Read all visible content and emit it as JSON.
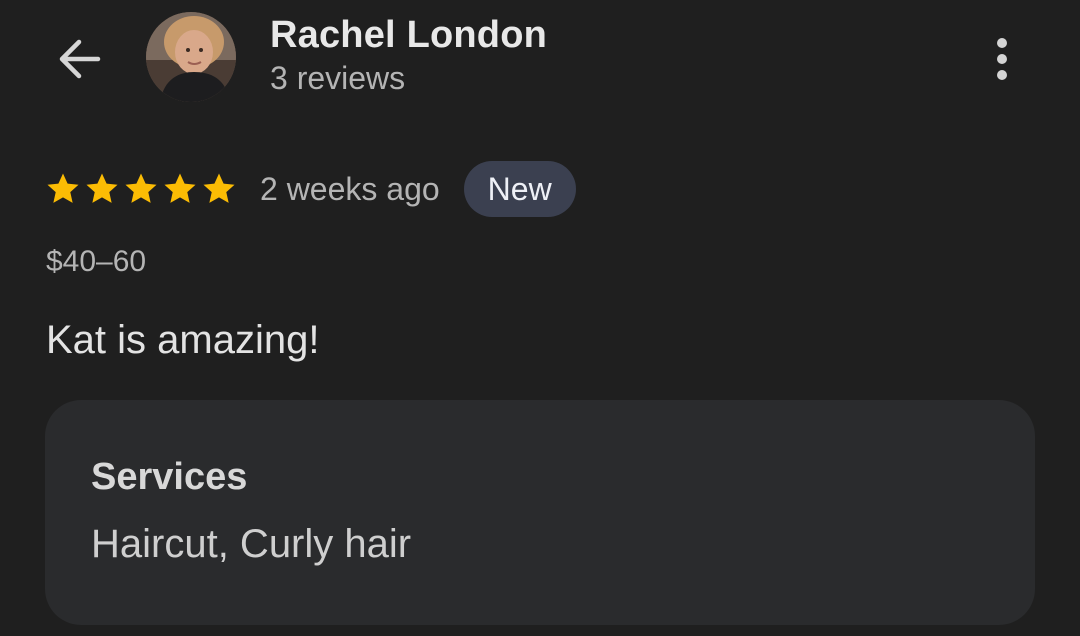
{
  "reviewer": {
    "name": "Rachel London",
    "review_count": "3 reviews"
  },
  "icons": {
    "back": "arrow-left-icon",
    "more": "more-vertical-icon",
    "star": "star-icon"
  },
  "review": {
    "rating": 5,
    "date": "2 weeks ago",
    "badge": "New",
    "price_range": "$40–60",
    "text": "Kat is amazing!"
  },
  "services": {
    "title": "Services",
    "value": "Haircut, Curly hair"
  },
  "colors": {
    "background": "#1f1f1f",
    "star": "#fbbc04",
    "badge_bg": "#3b4050",
    "card_bg": "#2a2b2d"
  }
}
